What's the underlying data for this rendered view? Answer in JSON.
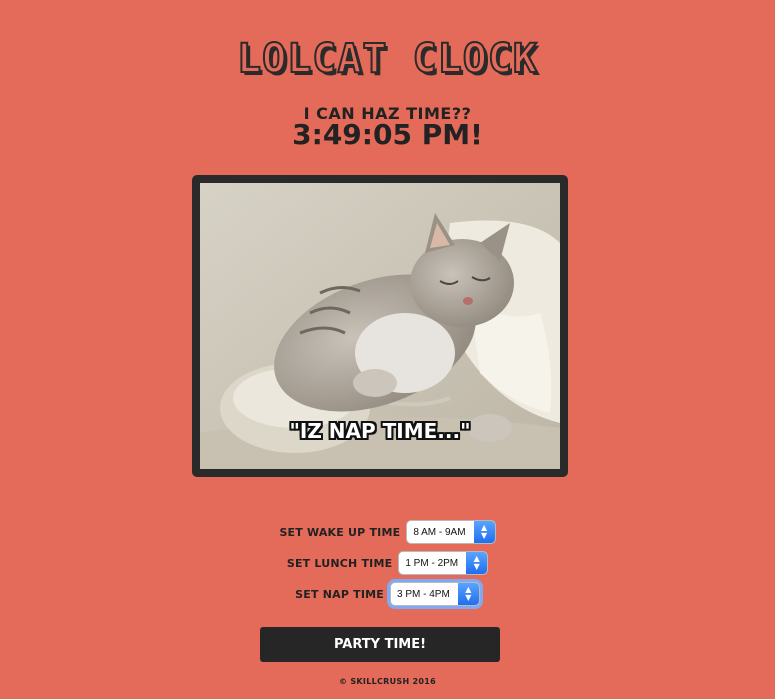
{
  "header": {
    "title": "LOLCAT CLOCK",
    "subtitle": "I CAN HAZ TIME??",
    "time": "3:49:05 PM!"
  },
  "image": {
    "caption": "\"IZ NAP TIME...\"",
    "subject": "sleeping-kitten-on-computer-mouse"
  },
  "settings": [
    {
      "label": "SET WAKE UP TIME",
      "value": "8 AM - 9AM",
      "focused": false
    },
    {
      "label": "SET LUNCH TIME",
      "value": "1 PM - 2PM",
      "focused": false
    },
    {
      "label": "SET NAP TIME",
      "value": "3 PM - 4PM",
      "focused": true
    }
  ],
  "actions": {
    "party_button": "PARTY TIME!"
  },
  "footer": {
    "text": "© SKILLCRUSH 2016"
  },
  "colors": {
    "background": "#e46a59",
    "text": "#222222",
    "button": "#262626",
    "select_arrow": "#1f6ef0"
  }
}
